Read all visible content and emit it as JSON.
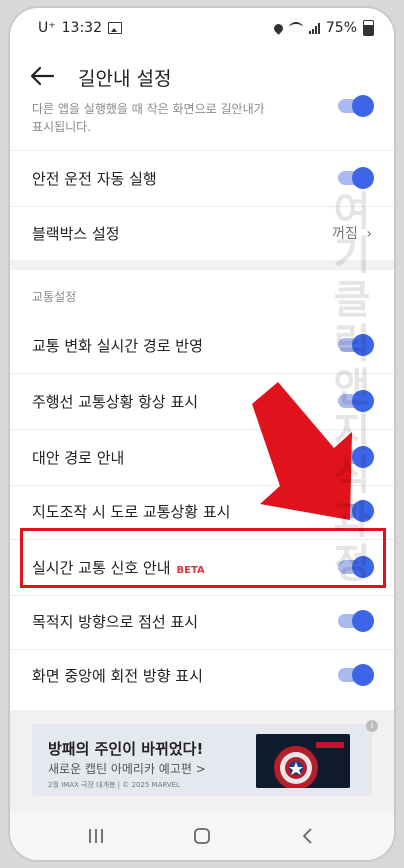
{
  "status": {
    "carrier": "U⁺",
    "time": "13:32",
    "battery": "75%"
  },
  "header": {
    "title": "길안내 설정"
  },
  "top_description": "다른 앱을 실행했을 때 작은 화면으로 길안내가\n표시됩니다.",
  "settings": [
    {
      "label": "안전 운전 자동 실행",
      "on": true
    },
    {
      "label": "블랙박스 설정",
      "value": "꺼짐"
    }
  ],
  "traffic_section": {
    "title": "교통설정",
    "items": [
      {
        "label": "교통 변화 실시간 경로 반영",
        "on": true
      },
      {
        "label": "주행선 교통상황 항상 표시",
        "on": true
      },
      {
        "label": "대안 경로 안내",
        "on": true
      },
      {
        "label": "지도조작 시 도로 교통상황 표시",
        "on": true
      },
      {
        "label": "실시간 교통 신호 안내",
        "badge": "BETA",
        "on": true
      },
      {
        "label": "목적지 방향으로 점선 표시",
        "on": true
      },
      {
        "label": "화면 중앙에 회전 방향 표시",
        "on": true
      }
    ]
  },
  "ad": {
    "title": "방패의 주인이 바뀌었다!",
    "subtitle": "새로운 캡틴 아메리카 예고편 >",
    "fineprint": "2월 IMAX 극장 대개봉 | © 2025 MARVEL"
  },
  "watermark": "여기클릭앤지식과정",
  "colors": {
    "accent": "#3d65e8",
    "highlight": "#e0121b",
    "arrow": "#e0121b"
  }
}
